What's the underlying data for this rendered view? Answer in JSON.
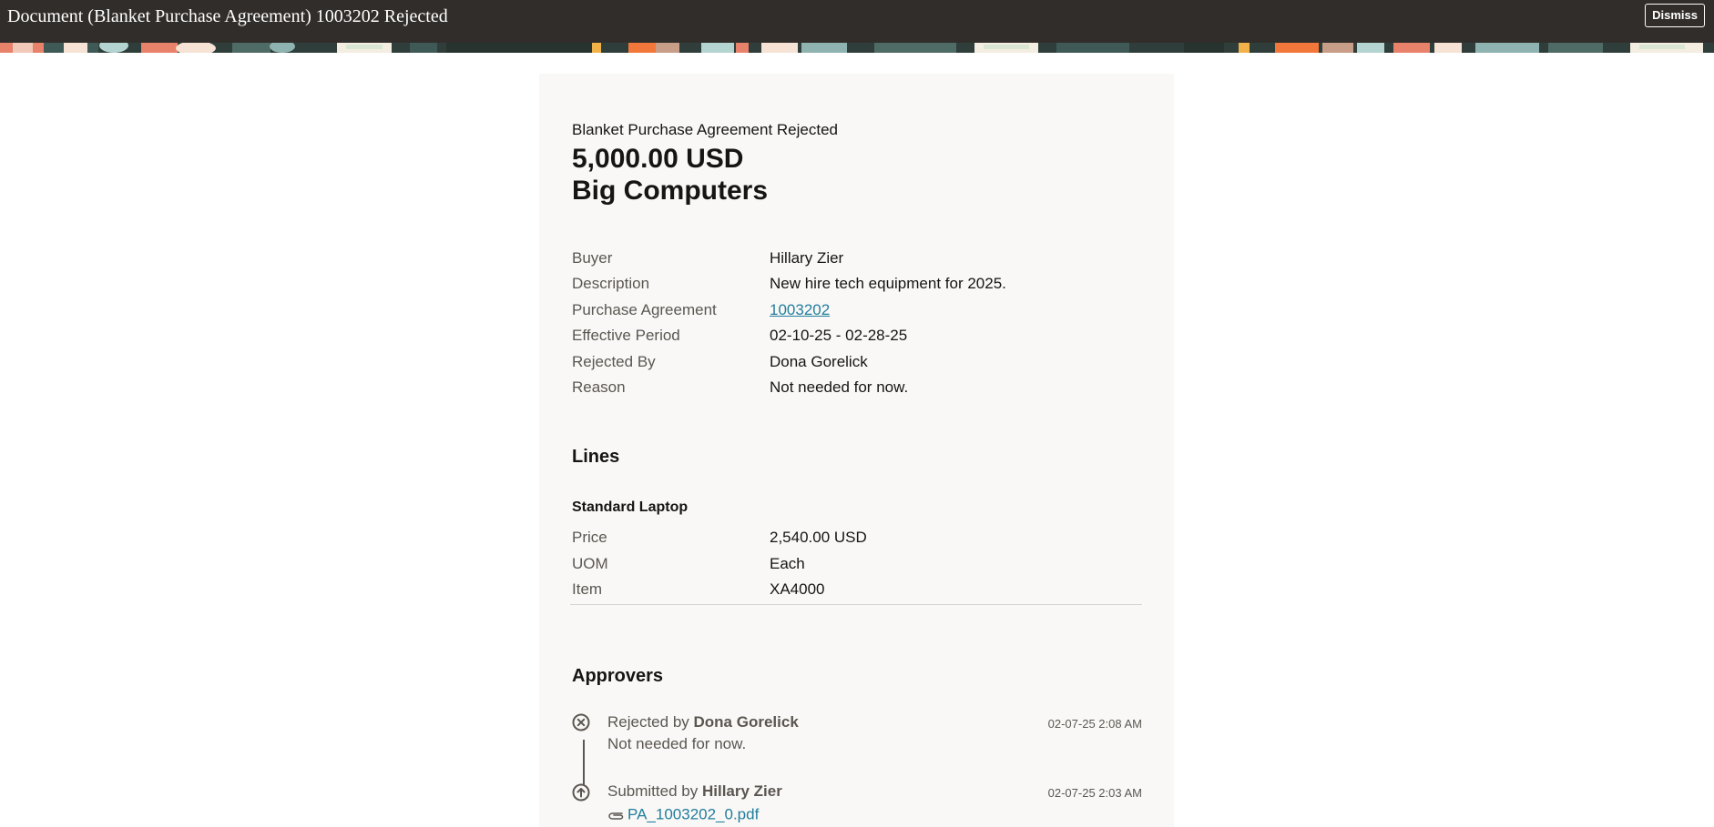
{
  "header": {
    "title": "Document (Blanket Purchase Agreement) 1003202 Rejected",
    "dismiss_label": "Dismiss"
  },
  "summary": {
    "subtitle": "Blanket Purchase Agreement Rejected",
    "amount": "5,000.00 USD",
    "supplier": "Big Computers"
  },
  "details": [
    {
      "label": "Buyer",
      "value": "Hillary Zier"
    },
    {
      "label": "Description",
      "value": "New hire tech equipment for 2025."
    },
    {
      "label": "Purchase Agreement",
      "value": "1003202"
    },
    {
      "label": "Effective Period",
      "value": "02-10-25 - 02-28-25"
    },
    {
      "label": "Rejected By",
      "value": "Dona Gorelick"
    },
    {
      "label": "Reason",
      "value": "Not needed for now."
    }
  ],
  "lines": {
    "title": "Lines",
    "items": [
      {
        "name": "Standard Laptop",
        "fields": [
          {
            "label": "Price",
            "value": "2,540.00 USD"
          },
          {
            "label": "UOM",
            "value": "Each"
          },
          {
            "label": "Item",
            "value": "XA4000"
          }
        ]
      }
    ]
  },
  "approvers": {
    "title": "Approvers",
    "entries": [
      {
        "action": "Rejected by",
        "name": "Dona Gorelick",
        "time": "02-07-25 2:08 AM",
        "note": "Not needed for now.",
        "icon": "rejected-x-icon"
      },
      {
        "action": "Submitted by",
        "name": "Hillary Zier",
        "time": "02-07-25 2:03 AM",
        "attachment": "PA_1003202_0.pdf",
        "icon": "submitted-arrow-up-icon"
      }
    ]
  },
  "colors": {
    "header_bg": "#312d2a",
    "card_bg": "#f9f8f6",
    "link": "#227e9e",
    "label": "#5b5652"
  }
}
